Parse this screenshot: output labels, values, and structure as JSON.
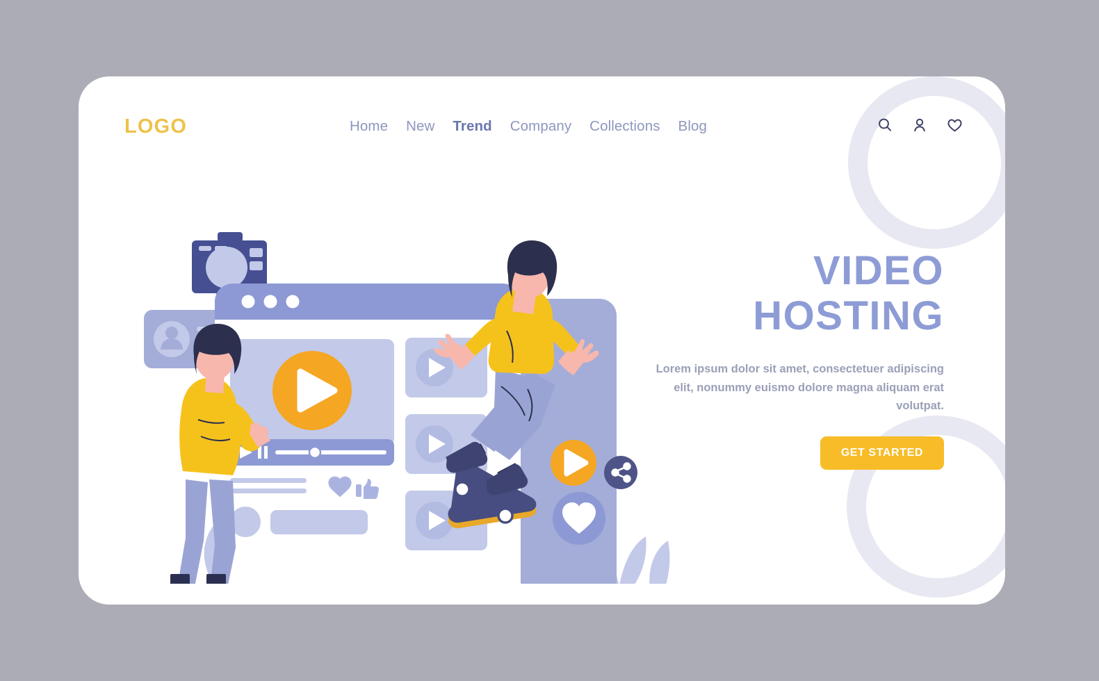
{
  "page": {
    "background_color": "#acacb6",
    "card_color": "#ffffff"
  },
  "header": {
    "logo": "LOGO",
    "logo_color": "#edc24a",
    "nav": [
      {
        "label": "Home",
        "active": false
      },
      {
        "label": "New",
        "active": false
      },
      {
        "label": "Trend",
        "active": true
      },
      {
        "label": "Company",
        "active": false
      },
      {
        "label": "Collections",
        "active": false
      },
      {
        "label": "Blog",
        "active": false
      }
    ],
    "icons": [
      {
        "name": "search-icon",
        "label": "Search"
      },
      {
        "name": "user-icon",
        "label": "Account"
      },
      {
        "name": "heart-icon",
        "label": "Favorites"
      }
    ],
    "nav_color": "#8e96bd",
    "nav_active_color": "#6a76ae",
    "icon_color": "#3f4266"
  },
  "hero": {
    "title_line1": "VIDEO",
    "title_line2": "HOSTING",
    "title_color": "#8e9cd6",
    "description": "Lorem ipsum dolor sit amet, consectetuer adipiscing elit, nonummy euismo dolore magna aliquam erat volutpat.",
    "description_color": "#9ba0b8",
    "cta_label": "GET STARTED",
    "cta_color": "#f7bc27",
    "cta_text_color": "#ffffff"
  },
  "illustration": {
    "name": "video-hosting-illustration",
    "browser_window": {
      "chrome_color": "#8d99d4",
      "body_color": "#ffffff",
      "dots": 3,
      "dot_color": "#ffffff"
    },
    "video_player": {
      "screen_color": "#c3c9e8",
      "play_button_color": "#f5a623",
      "play_icon_color": "#ffffff",
      "controls_bar_color": "#8d99d4",
      "progress_track_color": "#ffffff",
      "progress_knob_color": "#ffffff"
    },
    "thumbnails": {
      "count": 3,
      "card_color": "#c3c9e8",
      "play_circle_color": "#b2bbe2",
      "play_icon_color": "#ffffff"
    },
    "reactions": [
      {
        "name": "heart-icon",
        "color": "#aab3e0"
      },
      {
        "name": "thumbs-up-icon",
        "color": "#aab3e0"
      }
    ],
    "comment_row": {
      "avatar_color": "#c3c9e8",
      "input_color": "#c3c9e8"
    },
    "profile_card": {
      "card_color": "#a3add8",
      "avatar_color": "#c3c9e8",
      "line_color": "#c9cfec"
    },
    "camera": {
      "body_color": "#454f91",
      "lens_color": "#c3c9e8",
      "stand_color": "#a3add8"
    },
    "floating_bubbles": [
      {
        "name": "play-bubble",
        "color": "#f5a623"
      },
      {
        "name": "share-bubble",
        "color": "#4e5488"
      },
      {
        "name": "heart-bubble",
        "color": "#8d99d4"
      }
    ],
    "characters": [
      {
        "name": "woman-with-phone",
        "shirt_color": "#f5c21c",
        "pants_color": "#9aa4d4",
        "shoe_color": "#3f4372",
        "hair_color": "#2c2f4d",
        "skin_color": "#f7b7ad"
      },
      {
        "name": "skateboarder",
        "shirt_color": "#f5c21c",
        "pants_color": "#9aa4d4",
        "shoe_color": "#3f4372",
        "hair_color": "#2c2f4d",
        "skin_color": "#f7b7ad",
        "skateboard_color": "#474d80"
      }
    ],
    "ground_color": "#8d99d4",
    "leaf_color": "#c3c9e8"
  },
  "decorations": {
    "ring_color": "#e8e8f2",
    "rings": [
      {
        "name": "decorative-ring-top"
      },
      {
        "name": "decorative-ring-bottom"
      }
    ]
  }
}
